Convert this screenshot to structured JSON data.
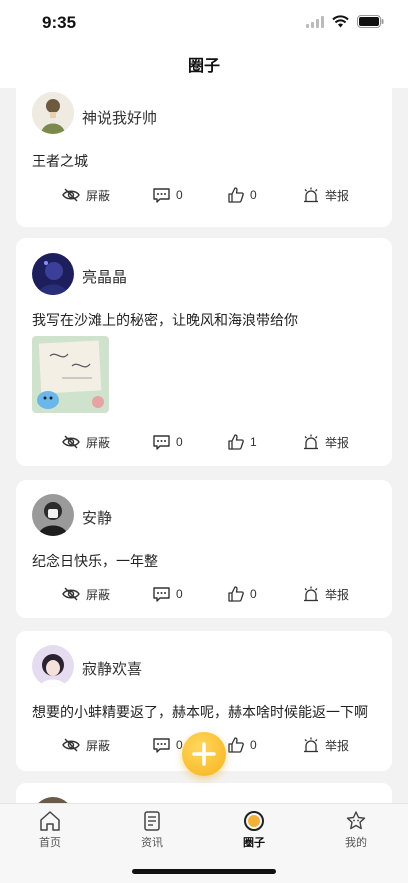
{
  "status": {
    "time": "9:35"
  },
  "header": {
    "title": "圈子"
  },
  "actions": {
    "hide_label": "屏蔽",
    "report_label": "举报"
  },
  "posts": [
    {
      "username": "神说我好帅",
      "text": "王者之城",
      "comments": "0",
      "likes": "0"
    },
    {
      "username": "亮晶晶",
      "text": "我写在沙滩上的秘密，让晚风和海浪带给你",
      "comments": "0",
      "likes": "1"
    },
    {
      "username": "安静",
      "text": "纪念日快乐，一年整",
      "comments": "0",
      "likes": "0"
    },
    {
      "username": "寂静欢喜",
      "text": "想要的小蚌精要返了，赫本呢，赫本啥时候能返一下啊",
      "comments": "0",
      "likes": "0"
    }
  ],
  "tabs": [
    {
      "label": "首页",
      "icon": "home-icon"
    },
    {
      "label": "资讯",
      "icon": "news-icon"
    },
    {
      "label": "圈子",
      "icon": "circle-icon",
      "active": true
    },
    {
      "label": "我的",
      "icon": "profile-icon"
    }
  ],
  "colors": {
    "accent": "#f7b21a",
    "background": "#f2f2f2"
  }
}
